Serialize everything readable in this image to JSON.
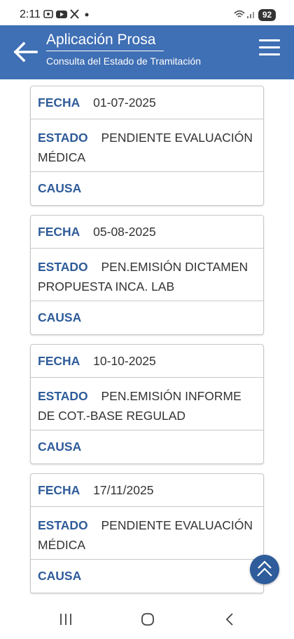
{
  "status": {
    "time": "2:11",
    "battery": "92",
    "icons": [
      "screen-record-icon",
      "youtube-icon",
      "x-icon",
      "dot-icon",
      "wifi-icon",
      "signal-icon"
    ]
  },
  "header": {
    "title": "Aplicación Prosa",
    "subtitle": "Consulta del Estado de Tramitación"
  },
  "labels": {
    "fecha": "FECHA",
    "estado": "ESTADO",
    "causa": "CAUSA"
  },
  "records": [
    {
      "fecha": "01-07-2025",
      "estado": "PENDIENTE EVALUACIÓN MÉDICA",
      "causa": ""
    },
    {
      "fecha": "05-08-2025",
      "estado": "PEN.EMISIÓN DICTAMEN PROPUESTA INCA. LAB",
      "causa": ""
    },
    {
      "fecha": "10-10-2025",
      "estado": "PEN.EMISIÓN INFORME DE COT.-BASE REGULAD",
      "causa": ""
    },
    {
      "fecha": "17/11/2025",
      "estado": "PENDIENTE EVALUACIÓN MÉDICA",
      "causa": ""
    }
  ],
  "colors": {
    "header": "#3f6fb4",
    "label": "#2f5c9a"
  }
}
